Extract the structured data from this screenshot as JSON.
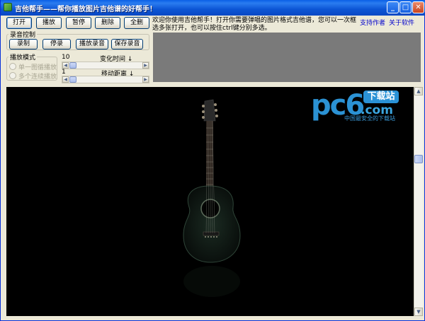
{
  "window": {
    "title": "吉他帮手——帮你播放图片吉他谱的好帮手！",
    "controls": {
      "minimize": "_",
      "maximize": "□",
      "close": "✕"
    }
  },
  "toolbar": {
    "open": "打开",
    "play": "播放",
    "pause": "暂停",
    "delete": "删除",
    "clear": "全删"
  },
  "description": "欢迎你使用吉他帮手！打开你需要弹唱的图片格式吉他谱，您可以一次框选多张打开，也可以按住ctrl键分别多选。",
  "links": {
    "support": "支持作者",
    "about": "关于软件"
  },
  "record": {
    "title": "录音控制",
    "record": "录制",
    "stop": "停录",
    "play_record": "播放录音",
    "save_record": "保存录音"
  },
  "play_mode": {
    "title": "播放模式",
    "options": [
      "单一图循播放",
      "多个连续播放"
    ]
  },
  "sliders": {
    "change_time": {
      "value": "10",
      "label": "变化时间 ↓"
    },
    "move_distance": {
      "value": "1",
      "label": "移动距离 ↓"
    }
  },
  "watermark": {
    "pc": "pc6",
    "com": ".com",
    "badge": "下载站",
    "tagline": "中国最安全的下载站"
  },
  "colors": {
    "title_bar": "#0a5fe6",
    "viewer_bg": "#000000",
    "panel_gray": "#7a7a7a",
    "link": "#0000cc",
    "logo_blue": "#2b92d4"
  }
}
